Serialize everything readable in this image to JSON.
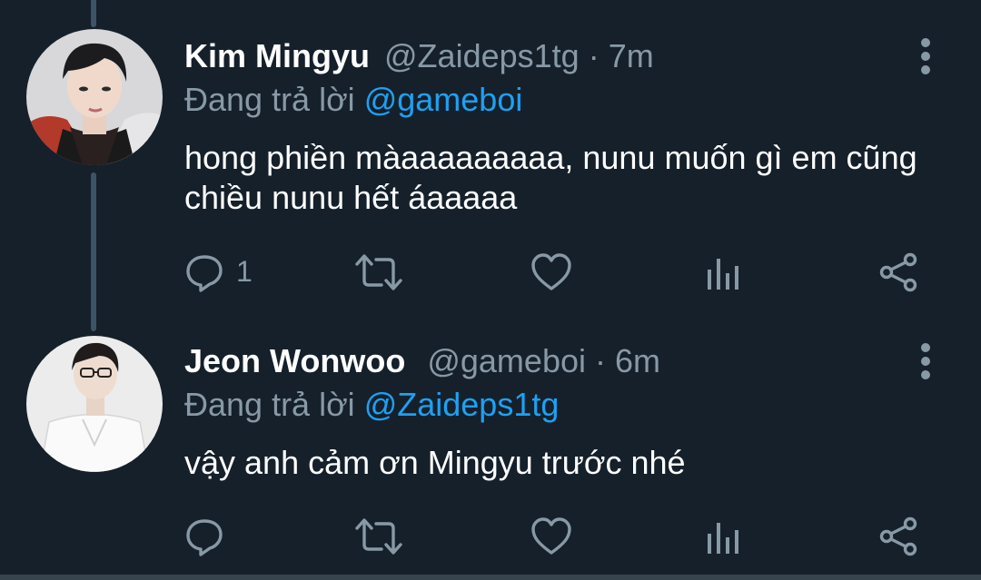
{
  "tweets": [
    {
      "name": "Kim Mingyu",
      "handle": "@Zaideps1tg",
      "separator": "·",
      "time": "7m",
      "reply_prefix": "Đang trả lời",
      "reply_to": "@gameboi",
      "text": "hong phiền màaaaaaaaaa, nunu muốn gì em cũng chiều nunu hết áaaaaa",
      "reply_count": "1",
      "icons": [
        "reply-icon",
        "retweet-icon",
        "like-icon",
        "analytics-icon",
        "share-icon",
        "more-icon"
      ]
    },
    {
      "name": "Jeon Wonwoo",
      "handle": "@gameboi",
      "separator": "·",
      "time": "6m",
      "reply_prefix": "Đang trả lời",
      "reply_to": "@Zaideps1tg",
      "text": "vậy anh cảm ơn Mingyu trước nhé",
      "reply_count": "",
      "icons": [
        "reply-icon",
        "retweet-icon",
        "like-icon",
        "analytics-icon",
        "share-icon",
        "more-icon"
      ]
    }
  ],
  "colors": {
    "background": "#15202b",
    "primary_text": "#ffffff",
    "secondary_text": "#8899a6",
    "mention": "#1da1f2",
    "thread_line": "#3d5466"
  }
}
